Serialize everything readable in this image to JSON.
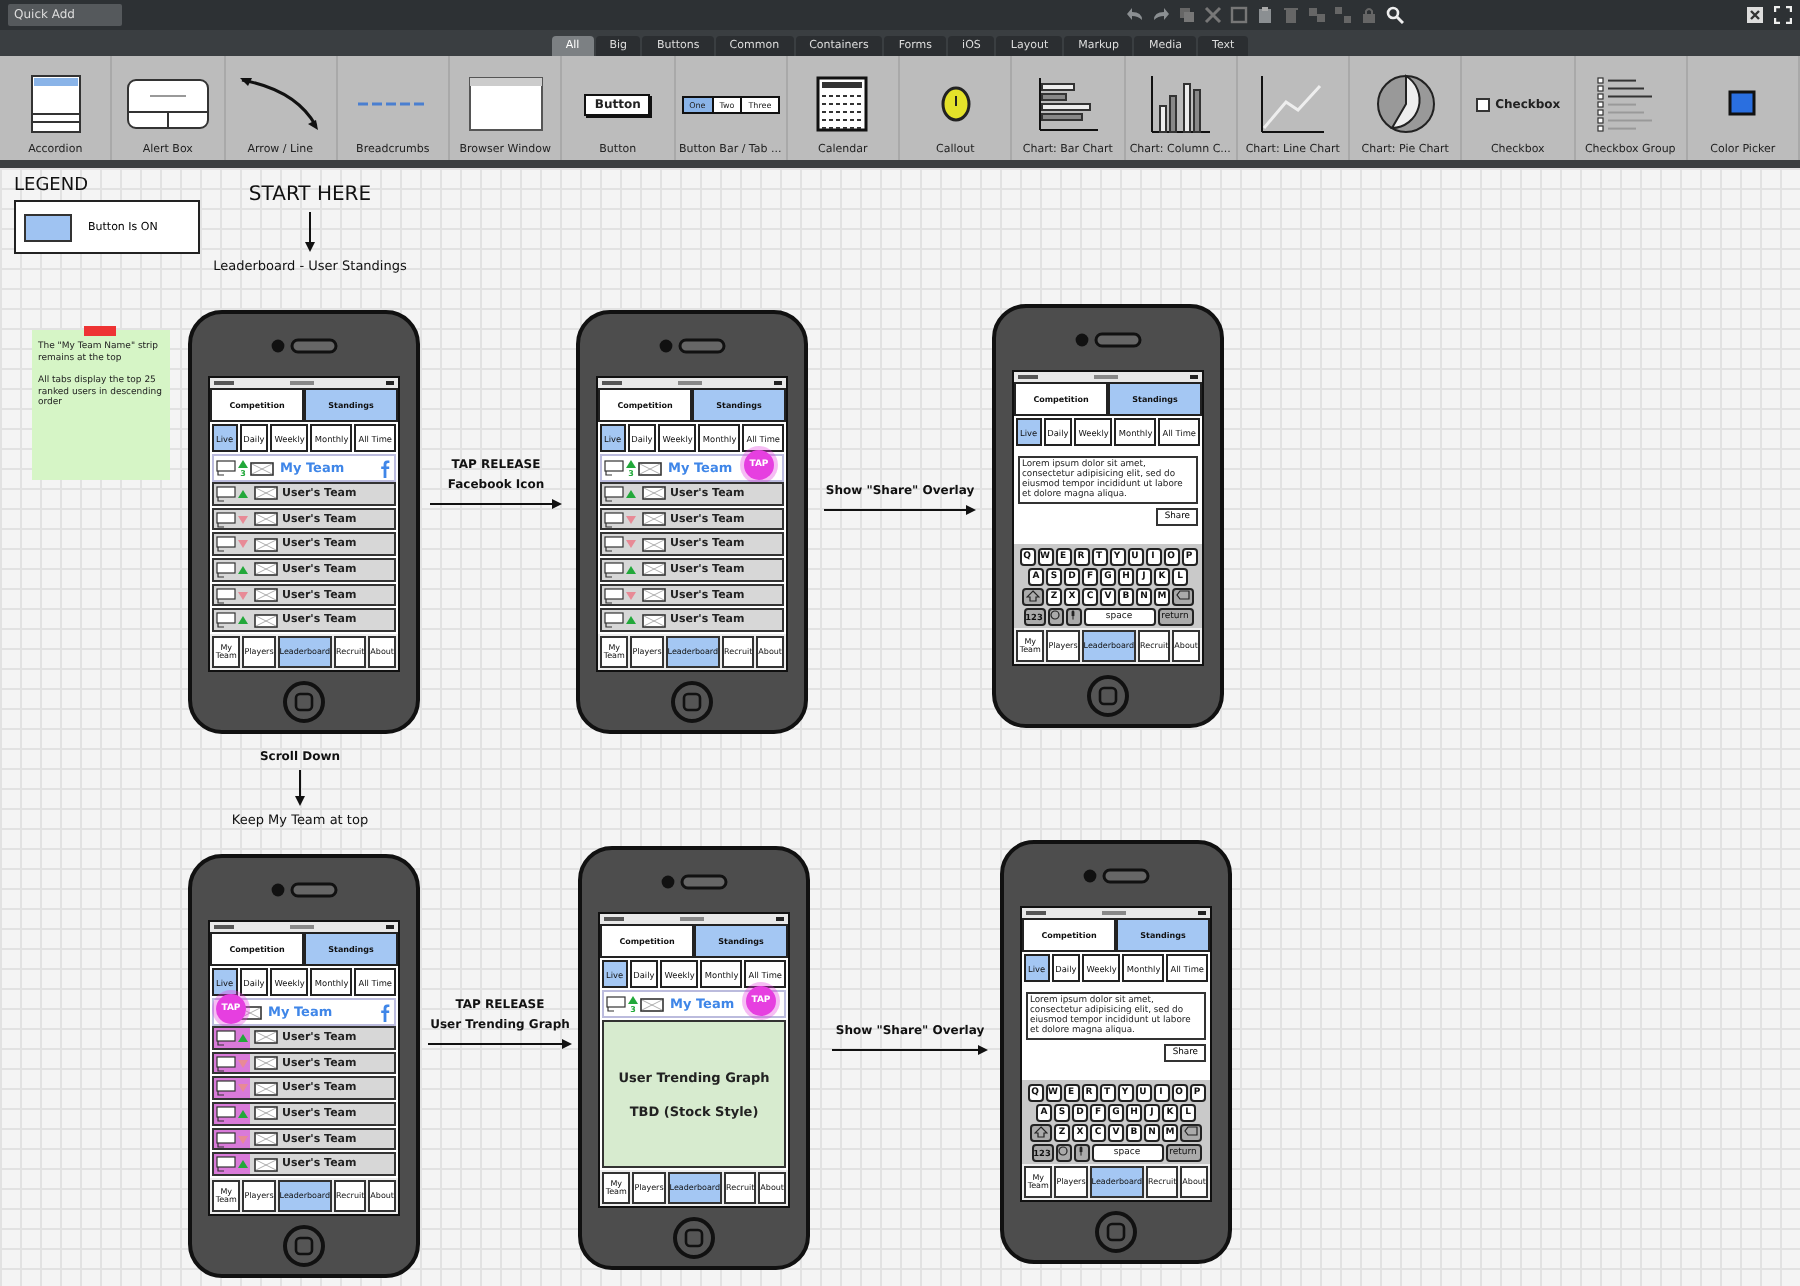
{
  "toolbar": {
    "quick_add": {
      "placeholder": "Quick Add"
    },
    "filters": [
      {
        "label": "All",
        "selected": true
      },
      {
        "label": "Big",
        "selected": false
      },
      {
        "label": "Buttons",
        "selected": false
      },
      {
        "label": "Common",
        "selected": false
      },
      {
        "label": "Containers",
        "selected": false
      },
      {
        "label": "Forms",
        "selected": false
      },
      {
        "label": "iOS",
        "selected": false
      },
      {
        "label": "Layout",
        "selected": false
      },
      {
        "label": "Markup",
        "selected": false
      },
      {
        "label": "Media",
        "selected": false
      },
      {
        "label": "Text",
        "selected": false
      }
    ],
    "components": [
      {
        "label": "Accordion",
        "kind": "accordion"
      },
      {
        "label": "Alert Box",
        "kind": "alert"
      },
      {
        "label": "Arrow / Line",
        "kind": "arrow"
      },
      {
        "label": "Breadcrumbs",
        "kind": "breadcrumbs"
      },
      {
        "label": "Browser Window",
        "kind": "browser"
      },
      {
        "label": "Button",
        "kind": "button",
        "preview": [
          "Button"
        ]
      },
      {
        "label": "Button Bar / Tab ...",
        "kind": "buttonbar",
        "preview": [
          "One",
          "Two",
          "Three"
        ]
      },
      {
        "label": "Calendar",
        "kind": "calendar"
      },
      {
        "label": "Callout",
        "kind": "callout"
      },
      {
        "label": "Chart: Bar Chart",
        "kind": "bar"
      },
      {
        "label": "Chart: Column C...",
        "kind": "column"
      },
      {
        "label": "Chart: Line Chart",
        "kind": "line"
      },
      {
        "label": "Chart: Pie Chart",
        "kind": "pie"
      },
      {
        "label": "Checkbox",
        "kind": "checkbox",
        "preview": [
          "Checkbox"
        ]
      },
      {
        "label": "Checkbox Group",
        "kind": "checkgroup"
      },
      {
        "label": "Color Picker",
        "kind": "color"
      }
    ]
  },
  "legend": {
    "title": "LEGEND",
    "item": "Button Is ON"
  },
  "start": {
    "title": "START HERE",
    "caption": "Leaderboard - User Standings"
  },
  "note": {
    "paragraphs": [
      "The \"My Team Name\" strip remains at the top",
      "All tabs display the top 25 ranked users in descending order"
    ]
  },
  "transitions": [
    {
      "lines": [
        "TAP RELEASE",
        "Facebook Icon"
      ]
    },
    {
      "lines": [
        "Show \"Share\" Overlay"
      ]
    },
    {
      "lines": [
        "Scroll Down"
      ],
      "caption": "Keep My Team at top"
    },
    {
      "lines": [
        "TAP RELEASE",
        "User Trending Graph"
      ]
    },
    {
      "lines": [
        "Show \"Share\" Overlay"
      ]
    }
  ],
  "phones": [
    {
      "kind": "list",
      "segments": [
        {
          "label": "Competition",
          "selected": false
        },
        {
          "label": "Standings",
          "selected": true
        }
      ],
      "periods": [
        {
          "label": "Live",
          "selected": true
        },
        {
          "label": "Daily",
          "selected": false
        },
        {
          "label": "Weekly",
          "selected": false
        },
        {
          "label": "Monthly",
          "selected": false
        },
        {
          "label": "All Time",
          "selected": false
        }
      ],
      "my_team": {
        "name": "My Team",
        "change": "3",
        "facebook_tapped": false,
        "rank_tapped": false
      },
      "rows": [
        {
          "name": "User's Team",
          "rising": true,
          "highlighted": false
        },
        {
          "name": "User's Team",
          "rising": false,
          "highlighted": false
        },
        {
          "name": "User's Team",
          "rising": false,
          "highlighted": false
        },
        {
          "name": "User's Team",
          "rising": true,
          "highlighted": false
        },
        {
          "name": "User's Team",
          "rising": false,
          "highlighted": false
        },
        {
          "name": "User's Team",
          "rising": true,
          "highlighted": false
        }
      ],
      "tabs": [
        {
          "label": "My Team",
          "selected": false
        },
        {
          "label": "Players",
          "selected": false
        },
        {
          "label": "Leaderboard",
          "selected": true
        },
        {
          "label": "Recruit",
          "selected": false
        },
        {
          "label": "About",
          "selected": false
        }
      ]
    },
    {
      "kind": "list",
      "segments": [
        {
          "label": "Competition",
          "selected": false
        },
        {
          "label": "Standings",
          "selected": true
        }
      ],
      "periods": [
        {
          "label": "Live",
          "selected": true
        },
        {
          "label": "Daily",
          "selected": false
        },
        {
          "label": "Weekly",
          "selected": false
        },
        {
          "label": "Monthly",
          "selected": false
        },
        {
          "label": "All Time",
          "selected": false
        }
      ],
      "my_team": {
        "name": "My Team",
        "change": "3",
        "facebook_tapped": true,
        "rank_tapped": false,
        "tap_label": "TAP"
      },
      "rows": [
        {
          "name": "User's Team",
          "rising": true,
          "highlighted": false
        },
        {
          "name": "User's Team",
          "rising": false,
          "highlighted": false
        },
        {
          "name": "User's Team",
          "rising": false,
          "highlighted": false
        },
        {
          "name": "User's Team",
          "rising": true,
          "highlighted": false
        },
        {
          "name": "User's Team",
          "rising": false,
          "highlighted": false
        },
        {
          "name": "User's Team",
          "rising": true,
          "highlighted": false
        }
      ],
      "tabs": [
        {
          "label": "My Team",
          "selected": false
        },
        {
          "label": "Players",
          "selected": false
        },
        {
          "label": "Leaderboard",
          "selected": true
        },
        {
          "label": "Recruit",
          "selected": false
        },
        {
          "label": "About",
          "selected": false
        }
      ]
    },
    {
      "kind": "share",
      "segments": [
        {
          "label": "Competition",
          "selected": false
        },
        {
          "label": "Standings",
          "selected": true
        }
      ],
      "periods": [
        {
          "label": "Live",
          "selected": true
        },
        {
          "label": "Daily",
          "selected": false
        },
        {
          "label": "Weekly",
          "selected": false
        },
        {
          "label": "Monthly",
          "selected": false
        },
        {
          "label": "All Time",
          "selected": false
        }
      ],
      "message": "Lorem ipsum dolor sit amet, consectetur adipisicing elit, sed do eiusmod tempor incididunt ut labore et dolore magna aliqua.",
      "send": "Share",
      "keys": [
        [
          "Q",
          "W",
          "E",
          "R",
          "T",
          "Y",
          "U",
          "I",
          "O",
          "P"
        ],
        [
          "A",
          "S",
          "D",
          "F",
          "G",
          "H",
          "J",
          "K",
          "L"
        ],
        [
          "Z",
          "X",
          "C",
          "V",
          "B",
          "N",
          "M"
        ]
      ],
      "bottom_keys": [
        "123",
        "space",
        "return"
      ],
      "tabs": [
        {
          "label": "My Team",
          "selected": false
        },
        {
          "label": "Players",
          "selected": false
        },
        {
          "label": "Leaderboard",
          "selected": true
        },
        {
          "label": "Recruit",
          "selected": false
        },
        {
          "label": "About",
          "selected": false
        }
      ]
    },
    {
      "kind": "list",
      "segments": [
        {
          "label": "Competition",
          "selected": false
        },
        {
          "label": "Standings",
          "selected": true
        }
      ],
      "periods": [
        {
          "label": "Live",
          "selected": true
        },
        {
          "label": "Daily",
          "selected": false
        },
        {
          "label": "Weekly",
          "selected": false
        },
        {
          "label": "Monthly",
          "selected": false
        },
        {
          "label": "All Time",
          "selected": false
        }
      ],
      "my_team": {
        "name": "My Team",
        "facebook_tapped": false,
        "rank_tapped": true,
        "tap_label": "TAP"
      },
      "rows": [
        {
          "name": "User's Team",
          "rising": true,
          "highlighted": true
        },
        {
          "name": "User's Team",
          "rising": false,
          "highlighted": true
        },
        {
          "name": "User's Team",
          "rising": false,
          "highlighted": true
        },
        {
          "name": "User's Team",
          "rising": true,
          "highlighted": true
        },
        {
          "name": "User's Team",
          "rising": false,
          "highlighted": true
        },
        {
          "name": "User's Team",
          "rising": true,
          "highlighted": true
        }
      ],
      "tabs": [
        {
          "label": "My Team",
          "selected": false
        },
        {
          "label": "Players",
          "selected": false
        },
        {
          "label": "Leaderboard",
          "selected": true
        },
        {
          "label": "Recruit",
          "selected": false
        },
        {
          "label": "About",
          "selected": false
        }
      ]
    },
    {
      "kind": "graph",
      "segments": [
        {
          "label": "Competition",
          "selected": false
        },
        {
          "label": "Standings",
          "selected": true
        }
      ],
      "periods": [
        {
          "label": "Live",
          "selected": true
        },
        {
          "label": "Daily",
          "selected": false
        },
        {
          "label": "Weekly",
          "selected": false
        },
        {
          "label": "Monthly",
          "selected": false
        },
        {
          "label": "All Time",
          "selected": false
        }
      ],
      "my_team": {
        "name": "My Team",
        "change": "3",
        "facebook_tapped": true,
        "rank_tapped": false,
        "tap_label": "TAP"
      },
      "graph": {
        "title": "User Trending Graph",
        "subtitle": "TBD (Stock Style)"
      },
      "tabs": [
        {
          "label": "My Team",
          "selected": false
        },
        {
          "label": "Players",
          "selected": false
        },
        {
          "label": "Leaderboard",
          "selected": true
        },
        {
          "label": "Recruit",
          "selected": false
        },
        {
          "label": "About",
          "selected": false
        }
      ]
    },
    {
      "kind": "share",
      "segments": [
        {
          "label": "Competition",
          "selected": false
        },
        {
          "label": "Standings",
          "selected": true
        }
      ],
      "periods": [
        {
          "label": "Live",
          "selected": true
        },
        {
          "label": "Daily",
          "selected": false
        },
        {
          "label": "Weekly",
          "selected": false
        },
        {
          "label": "Monthly",
          "selected": false
        },
        {
          "label": "All Time",
          "selected": false
        }
      ],
      "message": "Lorem ipsum dolor sit amet, consectetur adipisicing elit, sed do eiusmod tempor incididunt ut labore et dolore magna aliqua.",
      "send": "Share",
      "keys": [
        [
          "Q",
          "W",
          "E",
          "R",
          "T",
          "Y",
          "U",
          "I",
          "O",
          "P"
        ],
        [
          "A",
          "S",
          "D",
          "F",
          "G",
          "H",
          "J",
          "K",
          "L"
        ],
        [
          "Z",
          "X",
          "C",
          "V",
          "B",
          "N",
          "M"
        ]
      ],
      "bottom_keys": [
        "123",
        "space",
        "return"
      ],
      "tabs": [
        {
          "label": "My Team",
          "selected": false
        },
        {
          "label": "Players",
          "selected": false
        },
        {
          "label": "Leaderboard",
          "selected": true
        },
        {
          "label": "Recruit",
          "selected": false
        },
        {
          "label": "About",
          "selected": false
        }
      ]
    }
  ]
}
